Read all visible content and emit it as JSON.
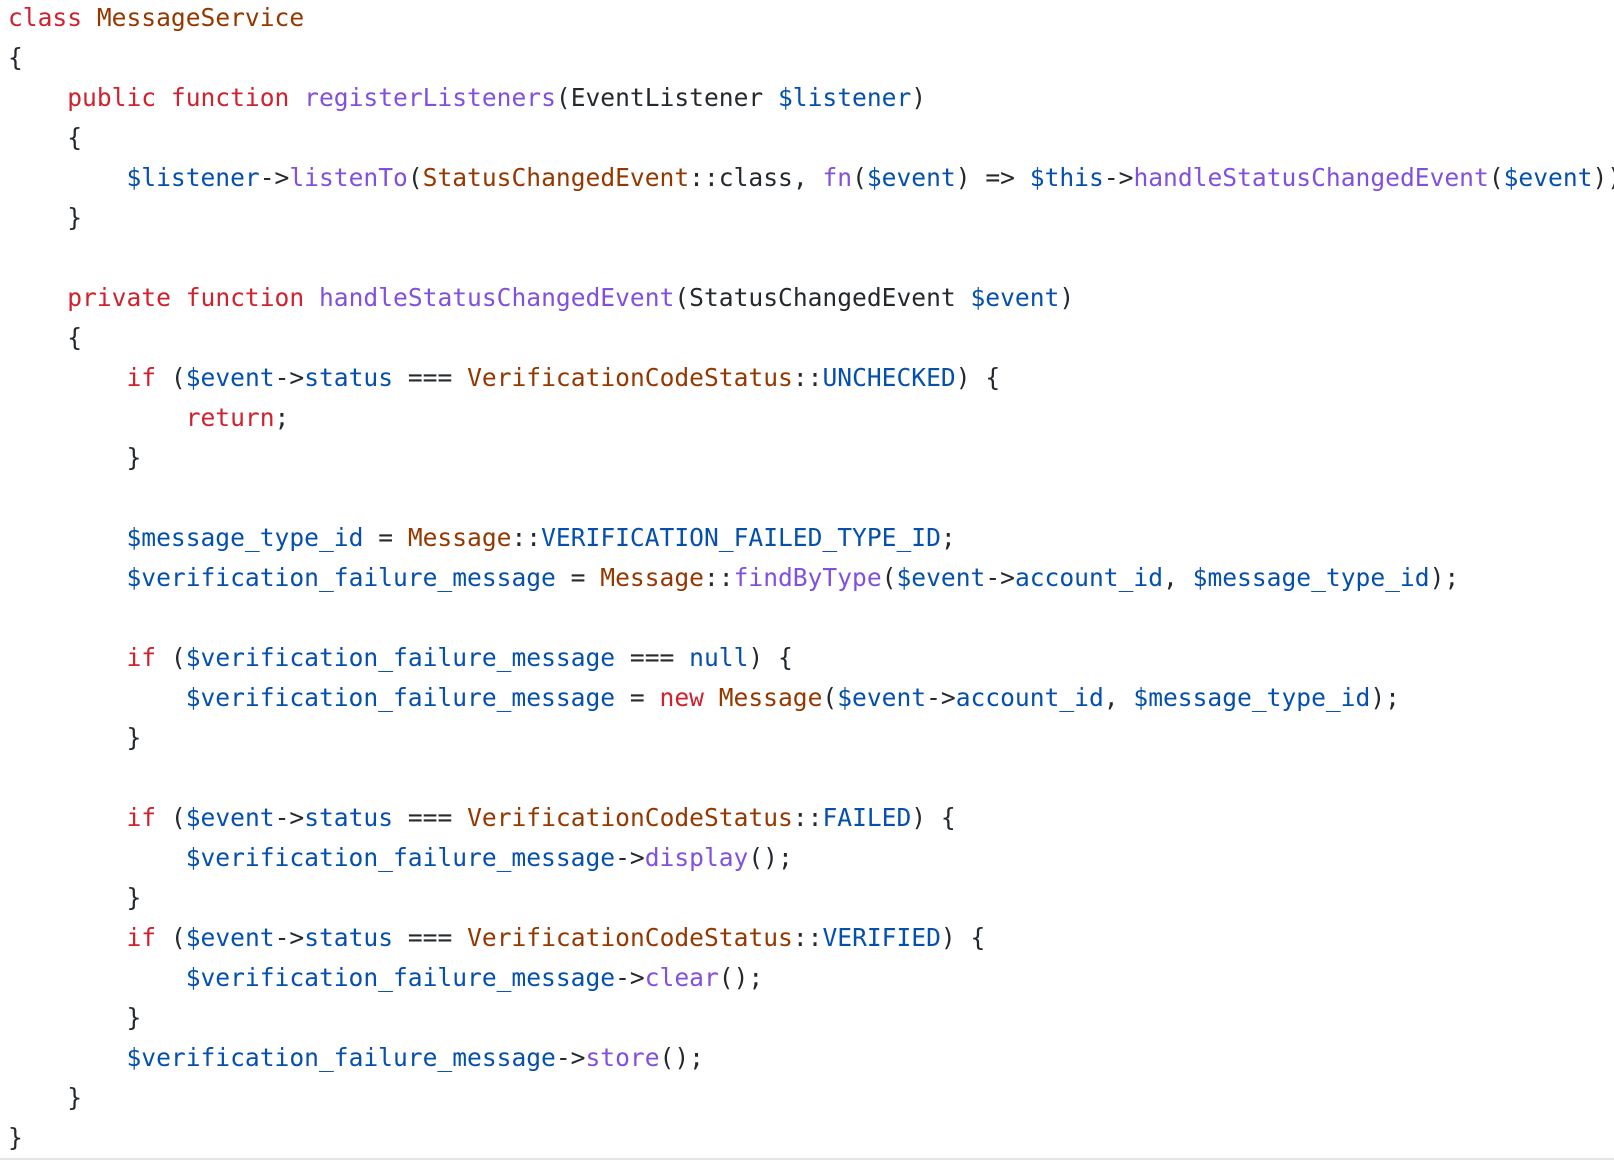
{
  "colors": {
    "keyword": "#cf222e",
    "class_name": "#953800",
    "function_name": "#8250df",
    "variable": "#0550ae",
    "plain": "#24292e",
    "property": "#0550ae"
  },
  "code": {
    "language": "php",
    "lines": [
      [
        [
          "keyword",
          "class"
        ],
        [
          "plain",
          " "
        ],
        [
          "class_name",
          "MessageService"
        ]
      ],
      [
        [
          "plain",
          "{"
        ]
      ],
      [
        [
          "plain",
          "    "
        ],
        [
          "keyword",
          "public"
        ],
        [
          "plain",
          " "
        ],
        [
          "keyword",
          "function"
        ],
        [
          "plain",
          " "
        ],
        [
          "function_name",
          "registerListeners"
        ],
        [
          "plain",
          "(EventListener "
        ],
        [
          "variable",
          "$listener"
        ],
        [
          "plain",
          ")"
        ]
      ],
      [
        [
          "plain",
          "    {"
        ]
      ],
      [
        [
          "plain",
          "        "
        ],
        [
          "variable",
          "$listener"
        ],
        [
          "plain",
          "->"
        ],
        [
          "function_name",
          "listenTo"
        ],
        [
          "plain",
          "("
        ],
        [
          "class_name",
          "StatusChangedEvent"
        ],
        [
          "plain",
          "::class, "
        ],
        [
          "function_name",
          "fn"
        ],
        [
          "plain",
          "("
        ],
        [
          "variable",
          "$event"
        ],
        [
          "plain",
          ") => "
        ],
        [
          "variable",
          "$this"
        ],
        [
          "plain",
          "->"
        ],
        [
          "function_name",
          "handleStatusChangedEvent"
        ],
        [
          "plain",
          "("
        ],
        [
          "variable",
          "$event"
        ],
        [
          "plain",
          "));"
        ]
      ],
      [
        [
          "plain",
          "    }"
        ]
      ],
      [
        [
          "plain",
          ""
        ]
      ],
      [
        [
          "plain",
          "    "
        ],
        [
          "keyword",
          "private"
        ],
        [
          "plain",
          " "
        ],
        [
          "keyword",
          "function"
        ],
        [
          "plain",
          " "
        ],
        [
          "function_name",
          "handleStatusChangedEvent"
        ],
        [
          "plain",
          "(StatusChangedEvent "
        ],
        [
          "variable",
          "$event"
        ],
        [
          "plain",
          ")"
        ]
      ],
      [
        [
          "plain",
          "    {"
        ]
      ],
      [
        [
          "plain",
          "        "
        ],
        [
          "keyword",
          "if"
        ],
        [
          "plain",
          " ("
        ],
        [
          "variable",
          "$event"
        ],
        [
          "plain",
          "->"
        ],
        [
          "property",
          "status"
        ],
        [
          "plain",
          " === "
        ],
        [
          "class_name",
          "VerificationCodeStatus"
        ],
        [
          "plain",
          "::"
        ],
        [
          "property",
          "UNCHECKED"
        ],
        [
          "plain",
          ") {"
        ]
      ],
      [
        [
          "plain",
          "            "
        ],
        [
          "keyword",
          "return"
        ],
        [
          "plain",
          ";"
        ]
      ],
      [
        [
          "plain",
          "        }"
        ]
      ],
      [
        [
          "plain",
          ""
        ]
      ],
      [
        [
          "plain",
          "        "
        ],
        [
          "variable",
          "$message_type_id"
        ],
        [
          "plain",
          " = "
        ],
        [
          "class_name",
          "Message"
        ],
        [
          "plain",
          "::"
        ],
        [
          "property",
          "VERIFICATION_FAILED_TYPE_ID"
        ],
        [
          "plain",
          ";"
        ]
      ],
      [
        [
          "plain",
          "        "
        ],
        [
          "variable",
          "$verification_failure_message"
        ],
        [
          "plain",
          " = "
        ],
        [
          "class_name",
          "Message"
        ],
        [
          "plain",
          "::"
        ],
        [
          "function_name",
          "findByType"
        ],
        [
          "plain",
          "("
        ],
        [
          "variable",
          "$event"
        ],
        [
          "plain",
          "->"
        ],
        [
          "property",
          "account_id"
        ],
        [
          "plain",
          ", "
        ],
        [
          "variable",
          "$message_type_id"
        ],
        [
          "plain",
          ");"
        ]
      ],
      [
        [
          "plain",
          ""
        ]
      ],
      [
        [
          "plain",
          "        "
        ],
        [
          "keyword",
          "if"
        ],
        [
          "plain",
          " ("
        ],
        [
          "variable",
          "$verification_failure_message"
        ],
        [
          "plain",
          " === "
        ],
        [
          "property",
          "null"
        ],
        [
          "plain",
          ") {"
        ]
      ],
      [
        [
          "plain",
          "            "
        ],
        [
          "variable",
          "$verification_failure_message"
        ],
        [
          "plain",
          " = "
        ],
        [
          "keyword",
          "new"
        ],
        [
          "plain",
          " "
        ],
        [
          "class_name",
          "Message"
        ],
        [
          "plain",
          "("
        ],
        [
          "variable",
          "$event"
        ],
        [
          "plain",
          "->"
        ],
        [
          "property",
          "account_id"
        ],
        [
          "plain",
          ", "
        ],
        [
          "variable",
          "$message_type_id"
        ],
        [
          "plain",
          ");"
        ]
      ],
      [
        [
          "plain",
          "        }"
        ]
      ],
      [
        [
          "plain",
          ""
        ]
      ],
      [
        [
          "plain",
          "        "
        ],
        [
          "keyword",
          "if"
        ],
        [
          "plain",
          " ("
        ],
        [
          "variable",
          "$event"
        ],
        [
          "plain",
          "->"
        ],
        [
          "property",
          "status"
        ],
        [
          "plain",
          " === "
        ],
        [
          "class_name",
          "VerificationCodeStatus"
        ],
        [
          "plain",
          "::"
        ],
        [
          "property",
          "FAILED"
        ],
        [
          "plain",
          ") {"
        ]
      ],
      [
        [
          "plain",
          "            "
        ],
        [
          "variable",
          "$verification_failure_message"
        ],
        [
          "plain",
          "->"
        ],
        [
          "function_name",
          "display"
        ],
        [
          "plain",
          "();"
        ]
      ],
      [
        [
          "plain",
          "        }"
        ]
      ],
      [
        [
          "plain",
          "        "
        ],
        [
          "keyword",
          "if"
        ],
        [
          "plain",
          " ("
        ],
        [
          "variable",
          "$event"
        ],
        [
          "plain",
          "->"
        ],
        [
          "property",
          "status"
        ],
        [
          "plain",
          " === "
        ],
        [
          "class_name",
          "VerificationCodeStatus"
        ],
        [
          "plain",
          "::"
        ],
        [
          "property",
          "VERIFIED"
        ],
        [
          "plain",
          ") {"
        ]
      ],
      [
        [
          "plain",
          "            "
        ],
        [
          "variable",
          "$verification_failure_message"
        ],
        [
          "plain",
          "->"
        ],
        [
          "function_name",
          "clear"
        ],
        [
          "plain",
          "();"
        ]
      ],
      [
        [
          "plain",
          "        }"
        ]
      ],
      [
        [
          "plain",
          "        "
        ],
        [
          "variable",
          "$verification_failure_message"
        ],
        [
          "plain",
          "->"
        ],
        [
          "function_name",
          "store"
        ],
        [
          "plain",
          "();"
        ]
      ],
      [
        [
          "plain",
          "    }"
        ]
      ],
      [
        [
          "plain",
          "}"
        ]
      ]
    ]
  }
}
